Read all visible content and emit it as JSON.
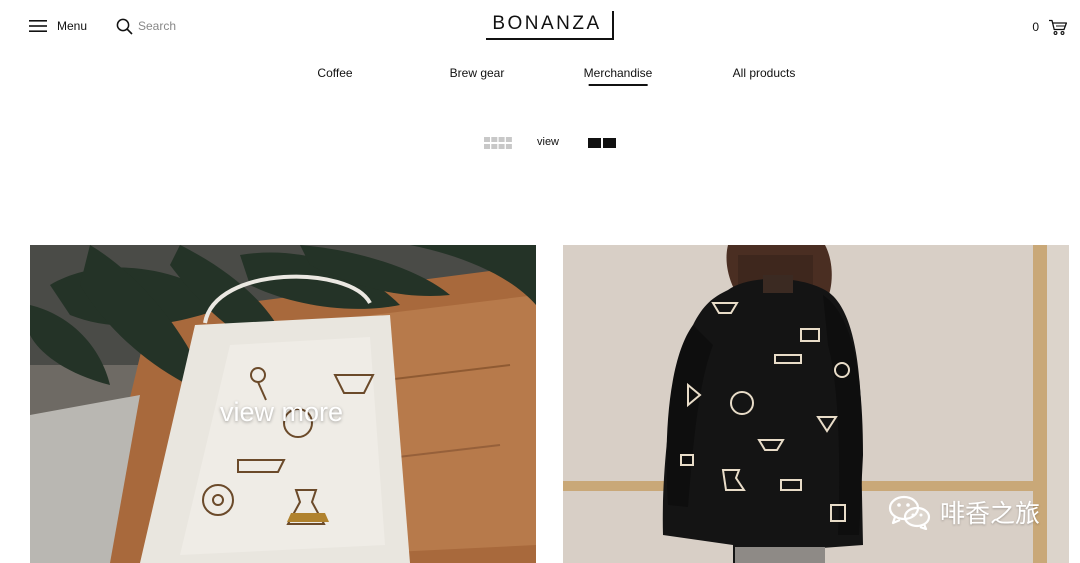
{
  "header": {
    "menu_label": "Menu",
    "search_label": "Search",
    "logo_text": "BONANZA",
    "cart_count": "0"
  },
  "categories": [
    {
      "label": "Coffee",
      "active": false
    },
    {
      "label": "Brew gear",
      "active": false
    },
    {
      "label": "Merchandise",
      "active": true
    },
    {
      "label": "All products",
      "active": false
    }
  ],
  "view_switch": {
    "label": "view",
    "options": [
      "grid-view-icon",
      "two-column-view-icon"
    ],
    "selected": "two-column-view-icon"
  },
  "products": [
    {
      "name": "tote-bag",
      "overlay_label": "view more"
    },
    {
      "name": "sweatshirt"
    }
  ],
  "watermark": {
    "text": "啡香之旅",
    "icon": "wechat-icon"
  },
  "colors": {
    "text": "#111111",
    "muted": "#888888",
    "inactive_grid": "#c8c8c8",
    "wood": "#b07646",
    "sweatshirt": "#141414",
    "wall": "#d9d0c8"
  }
}
